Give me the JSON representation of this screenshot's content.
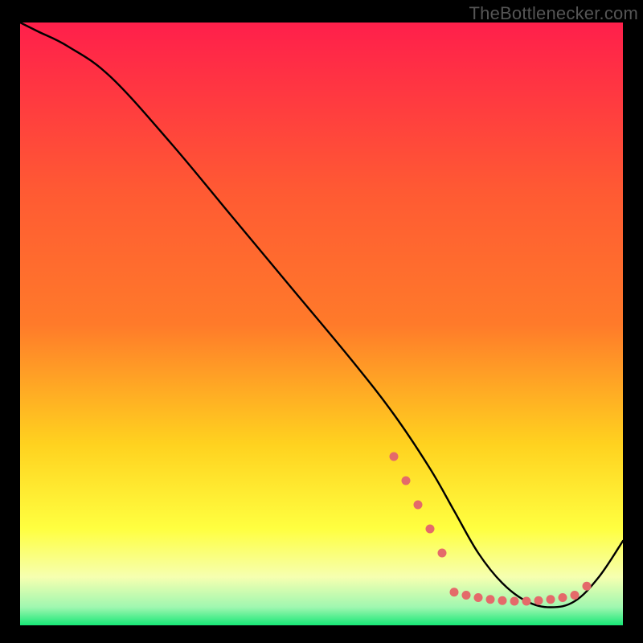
{
  "watermark": "TheBottlenecker.com",
  "colors": {
    "top": "#ff1f4b",
    "mid_upper": "#ff7a2a",
    "mid": "#ffd21f",
    "mid_lower": "#ffff40",
    "lower_light": "#f6ffb0",
    "bottom": "#17e776",
    "line": "#000000",
    "marker": "#e46a6a",
    "frame": "#000000"
  },
  "chart_data": {
    "type": "line",
    "title": "",
    "xlabel": "",
    "ylabel": "",
    "xlim": [
      0,
      100
    ],
    "ylim": [
      0,
      100
    ],
    "grid": false,
    "legend": false,
    "series": [
      {
        "name": "bottleneck-curve",
        "x": [
          0,
          3,
          8,
          15,
          25,
          35,
          45,
          55,
          62,
          68,
          72,
          76,
          80,
          84,
          88,
          92,
          96,
          100
        ],
        "y": [
          100,
          98.5,
          96,
          91,
          80,
          68,
          56,
          44,
          35,
          26,
          19,
          12,
          7,
          4,
          3,
          4,
          8,
          14
        ]
      }
    ],
    "markers": {
      "name": "optimal-zone-dots",
      "color": "#e46a6a",
      "points": [
        {
          "x": 62,
          "y": 28
        },
        {
          "x": 64,
          "y": 24
        },
        {
          "x": 66,
          "y": 20
        },
        {
          "x": 68,
          "y": 16
        },
        {
          "x": 70,
          "y": 12
        },
        {
          "x": 72,
          "y": 5.5
        },
        {
          "x": 74,
          "y": 5
        },
        {
          "x": 76,
          "y": 4.6
        },
        {
          "x": 78,
          "y": 4.3
        },
        {
          "x": 80,
          "y": 4.1
        },
        {
          "x": 82,
          "y": 4.0
        },
        {
          "x": 84,
          "y": 4.0
        },
        {
          "x": 86,
          "y": 4.1
        },
        {
          "x": 88,
          "y": 4.3
        },
        {
          "x": 90,
          "y": 4.6
        },
        {
          "x": 92,
          "y": 5.0
        },
        {
          "x": 94,
          "y": 6.5
        }
      ]
    }
  }
}
